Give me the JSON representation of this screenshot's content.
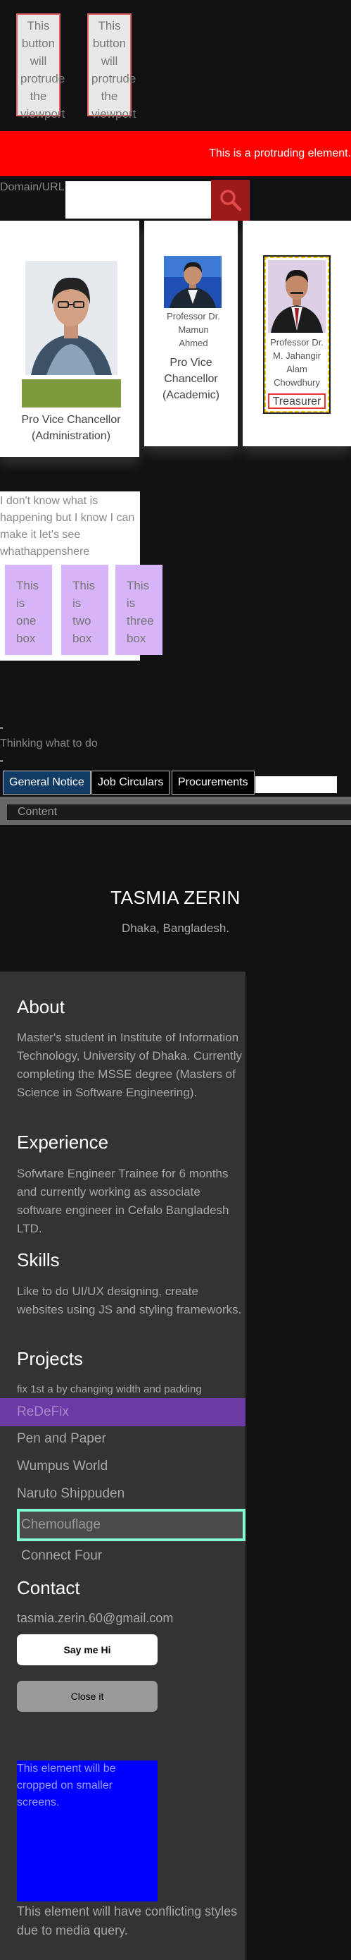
{
  "protrude_buttons": [
    {
      "label": "This button will protrude the viewport"
    },
    {
      "label": "This button will protrude the viewport"
    }
  ],
  "banner": {
    "text": "This is a protruding element."
  },
  "domain": {
    "label": "Domain/URL",
    "value": "",
    "search_icon": "search-icon",
    "search_color": "#9b1b1b"
  },
  "officials": [
    {
      "name": "",
      "role": "Pro Vice Chancellor (Administration)",
      "badge_color": "#7d9b3a"
    },
    {
      "name": "Professor Dr. Mamun Ahmed",
      "role": "Pro Vice Chancellor (Academic)"
    },
    {
      "name": "Professor Dr. M. Jahangir Alam Chowdhury",
      "role": "Treasurer"
    }
  ],
  "textbox": {
    "text": "I don't know what is happening but I know I can make it let's see whathappenshere"
  },
  "boxes": [
    "This is one box",
    "This is two box",
    "This is three box"
  ],
  "thinking": "Thinking what to do",
  "tabs": [
    {
      "label": "General Notice",
      "active": true
    },
    {
      "label": "Job Circulars",
      "active": false
    },
    {
      "label": "Procurements",
      "active": false
    }
  ],
  "content_label": "Content",
  "profile": {
    "name": "TASMIA ZERIN",
    "location": "Dhaka, Bangladesh."
  },
  "about": {
    "heading": "About",
    "text": "Master's student in Institute of Information Technology, University of Dhaka. Currently completing the MSSE degree (Masters of Science in Software Engineering)."
  },
  "experience": {
    "heading": "Experience",
    "text": "Sofwtare Engineer Trainee for 6 months and currently working as associate software engineer in Cefalo Bangladesh LTD."
  },
  "skills": {
    "heading": "Skills",
    "text": "Like to do UI/UX designing, create websites using JS and styling frameworks."
  },
  "projects": {
    "heading": "Projects",
    "note": "fix 1st a by changing width and padding",
    "items": [
      "ReDeFix",
      "Pen and Paper",
      "Wumpus World",
      "Naruto Shippuden",
      "Chemouflage",
      "Connect Four"
    ]
  },
  "contact": {
    "heading": "Contact",
    "email": "tasmia.zerin.60@gmail.com",
    "say_hi": "Say me Hi",
    "close": "Close it"
  },
  "blue_box": {
    "text": "This element will be cropped on smaller screens."
  },
  "conflict_note": "This element will have conflicting styles due to media query."
}
